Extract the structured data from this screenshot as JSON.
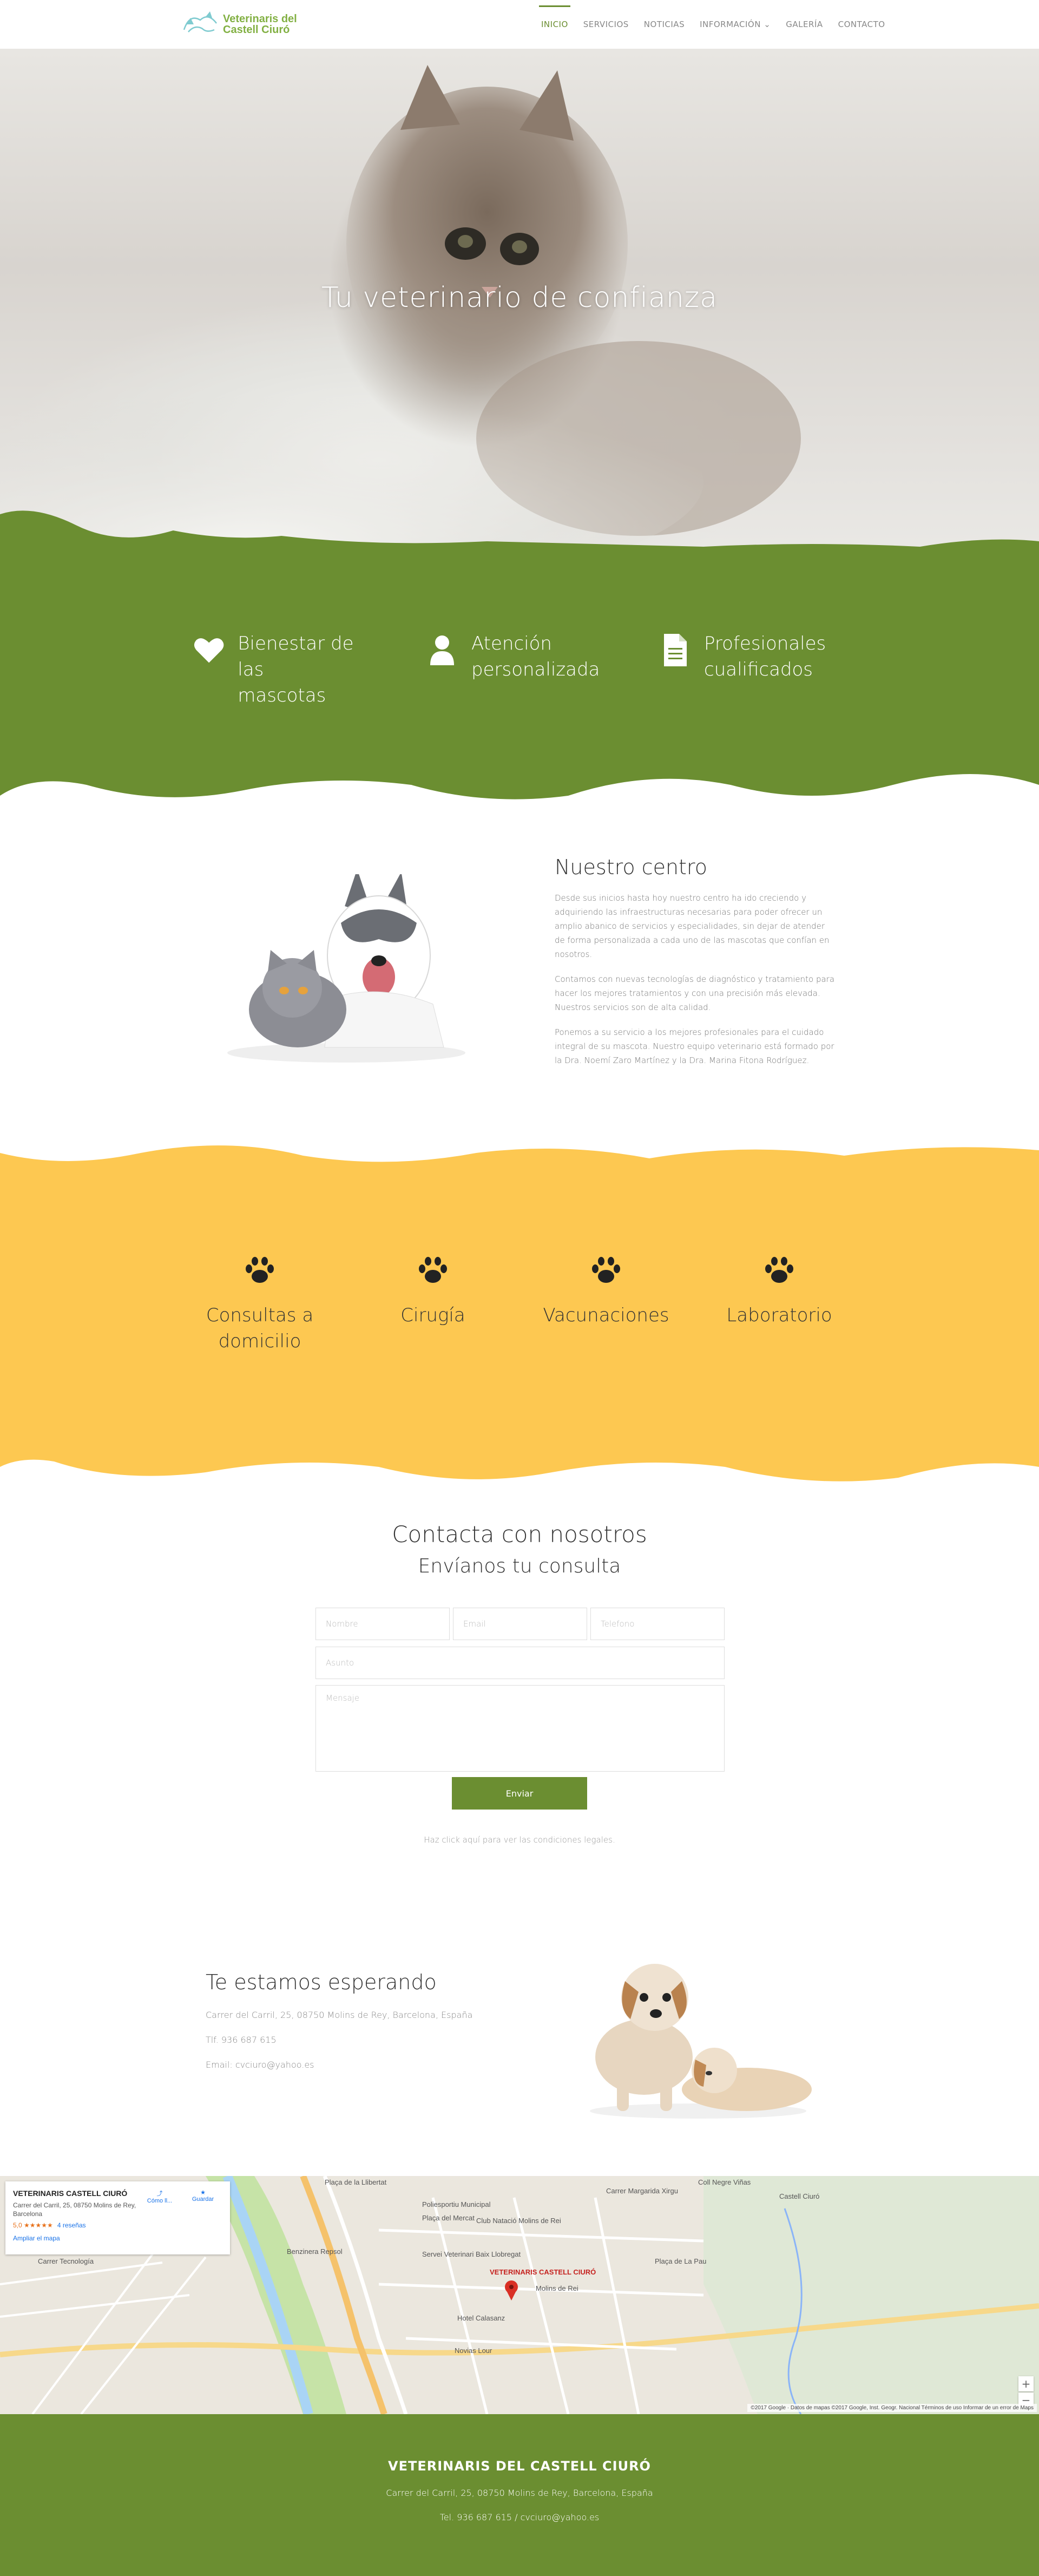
{
  "header": {
    "logo_text_line1": "Veterinaris del",
    "logo_text_line2": "Castell Ciuró",
    "nav": [
      {
        "label": "INICIO"
      },
      {
        "label": "SERVICIOS"
      },
      {
        "label": "NOTICIAS"
      },
      {
        "label": "INFORMACIÓN ⌄"
      },
      {
        "label": "GALERÍA"
      },
      {
        "label": "CONTACTO"
      }
    ]
  },
  "hero": {
    "title": "Tu veterinario de confianza"
  },
  "features": [
    {
      "icon": "heart-icon",
      "line1": "Bienestar de las",
      "line2": "mascotas"
    },
    {
      "icon": "user-icon",
      "line1": "Atención",
      "line2": "personalizada"
    },
    {
      "icon": "document-icon",
      "line1": "Profesionales",
      "line2": "cualificados"
    }
  ],
  "centro": {
    "title": "Nuestro centro",
    "paragraphs": [
      "Desde sus inicios hasta hoy nuestro centro ha ido creciendo y adquiriendo las infraestructuras necesarias para poder ofrecer un amplio abanico de servicios y especialidades, sin dejar de atender de forma personalizada a cada uno de las mascotas que confían en nosotros.",
      "Contamos con nuevas tecnologías de diagnóstico y tratamiento para hacer los mejores tratamientos y con una precisión más elevada. Nuestros servicios son de alta calidad.",
      "Ponemos a su servicio a los mejores profesionales para el cuidado integral de su mascota. Nuestro equipo veterinario está formado por la Dra. Noemí Zaro Martínez y la Dra. Marina Fitona Rodríguez."
    ]
  },
  "services": [
    {
      "icon": "paw-icon",
      "line1": "Consultas a",
      "line2": "domicilio"
    },
    {
      "icon": "paw-icon",
      "line1": "Cirugía",
      "line2": ""
    },
    {
      "icon": "paw-icon",
      "line1": "Vacunaciones",
      "line2": ""
    },
    {
      "icon": "paw-icon",
      "line1": "Laboratorio",
      "line2": ""
    }
  ],
  "contact": {
    "title": "Contacta con nosotros",
    "subtitle": "Envíanos tu consulta",
    "placeholders": {
      "nombre": "Nombre",
      "email": "Email",
      "telefono": "Telefono",
      "asunto": "Asunto",
      "mensaje": "Mensaje"
    },
    "submit_label": "Enviar",
    "legal_text": "Haz click aquí para ver las condiciones legales."
  },
  "esperando": {
    "title": "Te estamos esperando",
    "address": "Carrer del Carril, 25, 08750 Molins de Rey, Barcelona, España",
    "phone": "Tlf. 936 687 615",
    "email": "Email: cvciuro@yahoo.es"
  },
  "map": {
    "card_name": "VETERINARIS CASTELL CIURÓ",
    "card_address": "Carrer del Carril, 25, 08750 Molins de Rey, Barcelona",
    "rating": "5,0 ★★★★★",
    "reviews": "4 reseñas",
    "enlarge": "Ampliar el mapa",
    "action_directions": "Cómo ll...",
    "action_save": "Guardar",
    "labels": {
      "rambla": "Plaça de la Llibertat",
      "polideportivo": "Poliesportiu Municipal",
      "mercat": "Plaça del Mercat",
      "natacio": "Club Natació Molins de Rei",
      "bodega": "Benzinera Repsol",
      "servei": "Servei Veterinari Baix Llobregat",
      "marker": "VETERINARIS CASTELL CIURÓ",
      "hotel": "Hotel Calasanz",
      "novias": "Novias Lour",
      "castell": "Castell Ciuró",
      "coll": "Coll Negre Viñas",
      "placa_pau": "Plaça de La Pau",
      "rasa": "Carrer Margarida Xirgu",
      "molins": "Molins de Rei",
      "tecnologia": "Carrer Tecnología"
    },
    "attribution": "©2017 Google · Datos de mapas ©2017 Google, Inst. Geogr. Nacional   Términos de uso   Informar de un error de Maps"
  },
  "footer": {
    "title": "VETERINARIS DEL CASTELL CIURÓ",
    "address": "Carrer del Carril, 25, 08750 Molins de Rey, Barcelona, España",
    "contact": "Tel. 936 687 615 / cvciuro@yahoo.es"
  },
  "colors": {
    "green": "#6b8e31",
    "yellow": "#fdc851",
    "logo_green": "#82b043"
  }
}
